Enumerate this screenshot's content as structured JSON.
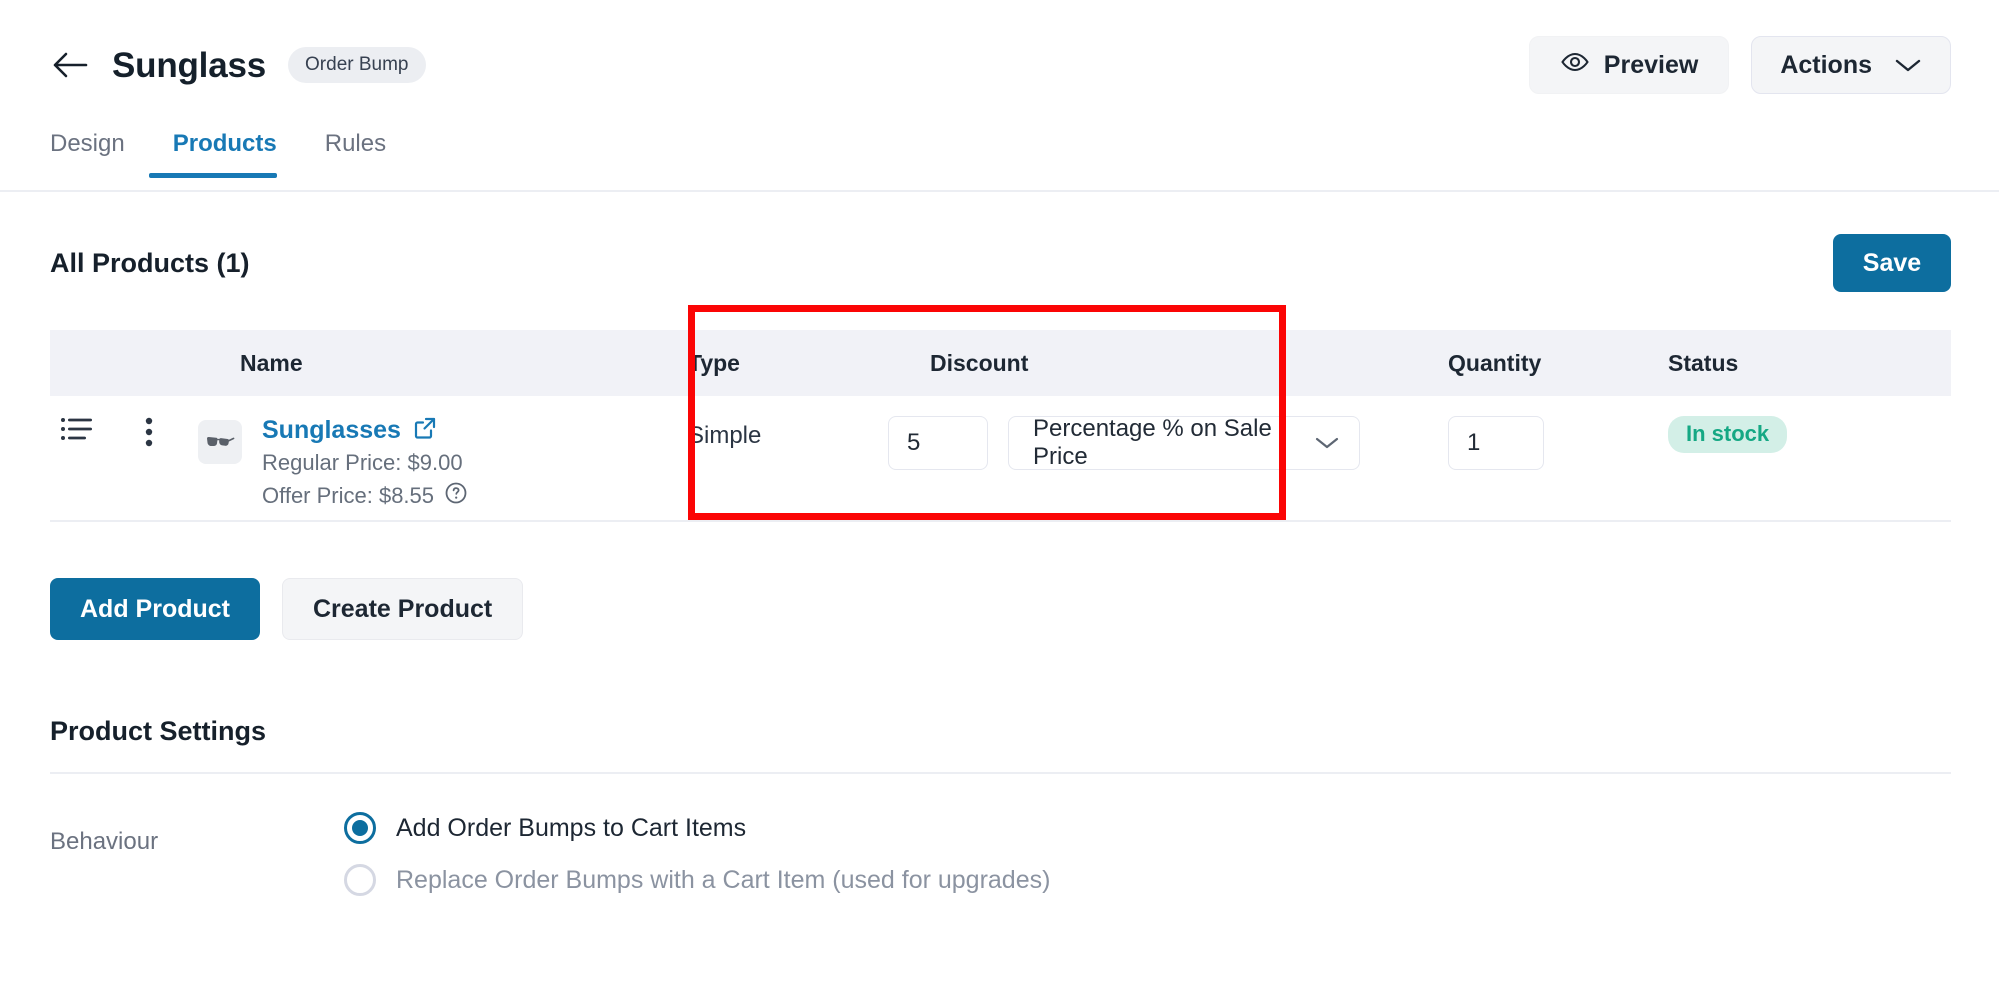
{
  "header": {
    "back_icon": "arrow-left-icon",
    "title": "Sunglass",
    "badge": "Order Bump",
    "preview_label": "Preview",
    "preview_icon": "eye-icon",
    "actions_label": "Actions",
    "actions_icon": "chevron-down-icon"
  },
  "tabs": [
    {
      "label": "Design",
      "active": false
    },
    {
      "label": "Products",
      "active": true
    },
    {
      "label": "Rules",
      "active": false
    }
  ],
  "section": {
    "title": "All Products (1)",
    "save_label": "Save"
  },
  "table": {
    "columns": {
      "name": "Name",
      "type": "Type",
      "discount": "Discount",
      "quantity": "Quantity",
      "status": "Status"
    },
    "rows": [
      {
        "handle_icon": "drag-handle-list-icon",
        "menu_icon": "kebab-menu-icon",
        "thumbnail_icon": "sunglasses-product-thumbnail",
        "name": "Sunglasses",
        "external_link_icon": "external-link-icon",
        "regular_price": "Regular Price: $9.00",
        "offer_price": "Offer Price: $8.55",
        "offer_help_icon": "help-circle-icon",
        "type": "Simple",
        "discount_value": "5",
        "discount_type": "Percentage % on Sale Price",
        "discount_type_icon": "chevron-down-icon",
        "quantity": "1",
        "status": "In stock"
      }
    ]
  },
  "buttons": {
    "add_product": "Add Product",
    "create_product": "Create Product"
  },
  "product_settings": {
    "title": "Product Settings",
    "behaviour_label": "Behaviour",
    "options": [
      {
        "label": "Add Order Bumps to Cart Items",
        "selected": true
      },
      {
        "label": "Replace Order Bumps with a Cart Item (used for upgrades)",
        "selected": false
      }
    ]
  },
  "annotation": {
    "highlight_color": "#fb0505",
    "target": "discount-column"
  },
  "colors": {
    "primary": "#0d6e9f",
    "tab_active": "#1879b5",
    "link": "#1879b5",
    "stock_text": "#15a884",
    "stock_bg": "#d3efe7",
    "header_row_bg": "#f1f2f7"
  }
}
